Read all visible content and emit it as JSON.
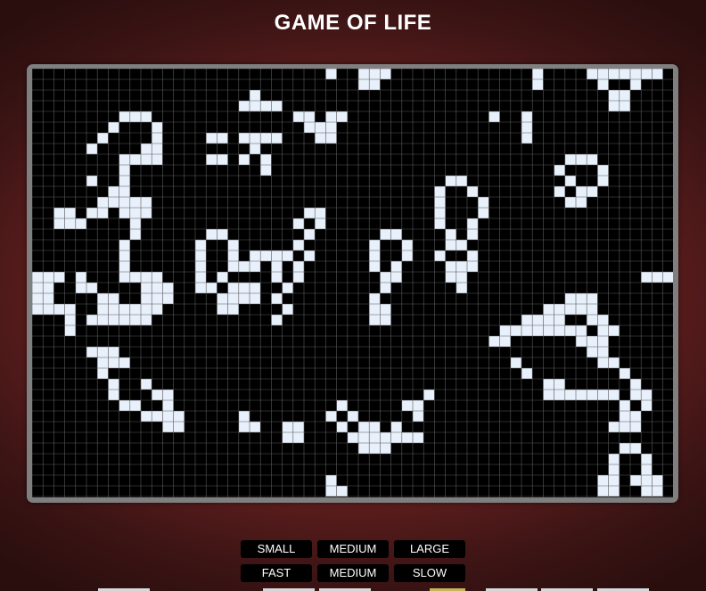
{
  "title": "GAME OF LIFE",
  "grid": {
    "cols": 59,
    "rows": 40,
    "cell_color": "#e8f0fb",
    "background": "#000000",
    "line_color": "#5a5a5a",
    "live": [
      "...........................A..AA........................",
      "..........................................C.....",
      "",
      "",
      "",
      "",
      "",
      "",
      "",
      "",
      "",
      "",
      "",
      "",
      "",
      "",
      "",
      "",
      "",
      "",
      "",
      "",
      "",
      "",
      "",
      "",
      "",
      "",
      "",
      "",
      "",
      "",
      "",
      "",
      "",
      "",
      "",
      "",
      "",
      ""
    ]
  },
  "size_buttons": [
    "SMALL",
    "MEDIUM",
    "LARGE"
  ],
  "speed_buttons": [
    "FAST",
    "MEDIUM",
    "SLOW"
  ]
}
